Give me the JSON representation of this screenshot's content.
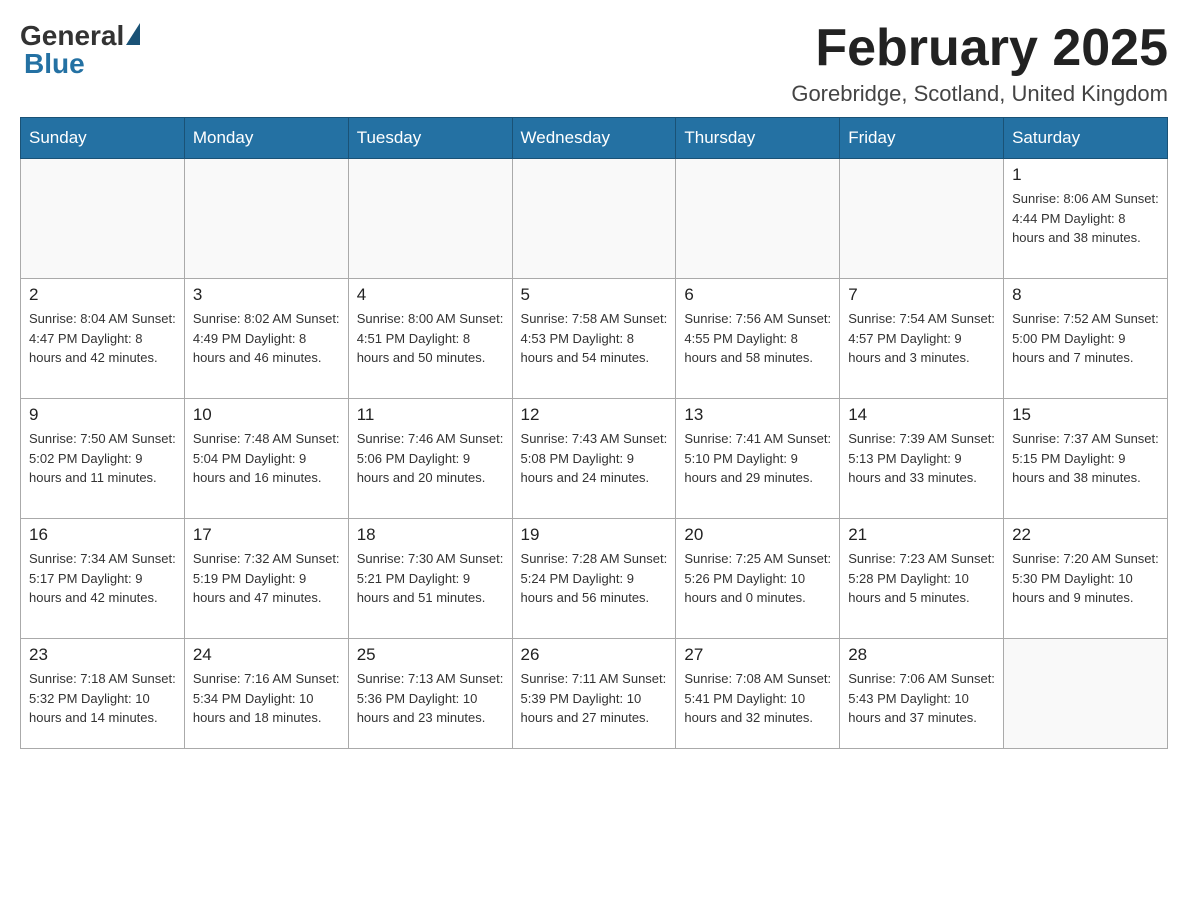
{
  "header": {
    "logo_general": "General",
    "logo_blue": "Blue",
    "title": "February 2025",
    "location": "Gorebridge, Scotland, United Kingdom"
  },
  "weekdays": [
    "Sunday",
    "Monday",
    "Tuesday",
    "Wednesday",
    "Thursday",
    "Friday",
    "Saturday"
  ],
  "weeks": [
    [
      {
        "day": "",
        "info": ""
      },
      {
        "day": "",
        "info": ""
      },
      {
        "day": "",
        "info": ""
      },
      {
        "day": "",
        "info": ""
      },
      {
        "day": "",
        "info": ""
      },
      {
        "day": "",
        "info": ""
      },
      {
        "day": "1",
        "info": "Sunrise: 8:06 AM\nSunset: 4:44 PM\nDaylight: 8 hours\nand 38 minutes."
      }
    ],
    [
      {
        "day": "2",
        "info": "Sunrise: 8:04 AM\nSunset: 4:47 PM\nDaylight: 8 hours\nand 42 minutes."
      },
      {
        "day": "3",
        "info": "Sunrise: 8:02 AM\nSunset: 4:49 PM\nDaylight: 8 hours\nand 46 minutes."
      },
      {
        "day": "4",
        "info": "Sunrise: 8:00 AM\nSunset: 4:51 PM\nDaylight: 8 hours\nand 50 minutes."
      },
      {
        "day": "5",
        "info": "Sunrise: 7:58 AM\nSunset: 4:53 PM\nDaylight: 8 hours\nand 54 minutes."
      },
      {
        "day": "6",
        "info": "Sunrise: 7:56 AM\nSunset: 4:55 PM\nDaylight: 8 hours\nand 58 minutes."
      },
      {
        "day": "7",
        "info": "Sunrise: 7:54 AM\nSunset: 4:57 PM\nDaylight: 9 hours\nand 3 minutes."
      },
      {
        "day": "8",
        "info": "Sunrise: 7:52 AM\nSunset: 5:00 PM\nDaylight: 9 hours\nand 7 minutes."
      }
    ],
    [
      {
        "day": "9",
        "info": "Sunrise: 7:50 AM\nSunset: 5:02 PM\nDaylight: 9 hours\nand 11 minutes."
      },
      {
        "day": "10",
        "info": "Sunrise: 7:48 AM\nSunset: 5:04 PM\nDaylight: 9 hours\nand 16 minutes."
      },
      {
        "day": "11",
        "info": "Sunrise: 7:46 AM\nSunset: 5:06 PM\nDaylight: 9 hours\nand 20 minutes."
      },
      {
        "day": "12",
        "info": "Sunrise: 7:43 AM\nSunset: 5:08 PM\nDaylight: 9 hours\nand 24 minutes."
      },
      {
        "day": "13",
        "info": "Sunrise: 7:41 AM\nSunset: 5:10 PM\nDaylight: 9 hours\nand 29 minutes."
      },
      {
        "day": "14",
        "info": "Sunrise: 7:39 AM\nSunset: 5:13 PM\nDaylight: 9 hours\nand 33 minutes."
      },
      {
        "day": "15",
        "info": "Sunrise: 7:37 AM\nSunset: 5:15 PM\nDaylight: 9 hours\nand 38 minutes."
      }
    ],
    [
      {
        "day": "16",
        "info": "Sunrise: 7:34 AM\nSunset: 5:17 PM\nDaylight: 9 hours\nand 42 minutes."
      },
      {
        "day": "17",
        "info": "Sunrise: 7:32 AM\nSunset: 5:19 PM\nDaylight: 9 hours\nand 47 minutes."
      },
      {
        "day": "18",
        "info": "Sunrise: 7:30 AM\nSunset: 5:21 PM\nDaylight: 9 hours\nand 51 minutes."
      },
      {
        "day": "19",
        "info": "Sunrise: 7:28 AM\nSunset: 5:24 PM\nDaylight: 9 hours\nand 56 minutes."
      },
      {
        "day": "20",
        "info": "Sunrise: 7:25 AM\nSunset: 5:26 PM\nDaylight: 10 hours\nand 0 minutes."
      },
      {
        "day": "21",
        "info": "Sunrise: 7:23 AM\nSunset: 5:28 PM\nDaylight: 10 hours\nand 5 minutes."
      },
      {
        "day": "22",
        "info": "Sunrise: 7:20 AM\nSunset: 5:30 PM\nDaylight: 10 hours\nand 9 minutes."
      }
    ],
    [
      {
        "day": "23",
        "info": "Sunrise: 7:18 AM\nSunset: 5:32 PM\nDaylight: 10 hours\nand 14 minutes."
      },
      {
        "day": "24",
        "info": "Sunrise: 7:16 AM\nSunset: 5:34 PM\nDaylight: 10 hours\nand 18 minutes."
      },
      {
        "day": "25",
        "info": "Sunrise: 7:13 AM\nSunset: 5:36 PM\nDaylight: 10 hours\nand 23 minutes."
      },
      {
        "day": "26",
        "info": "Sunrise: 7:11 AM\nSunset: 5:39 PM\nDaylight: 10 hours\nand 27 minutes."
      },
      {
        "day": "27",
        "info": "Sunrise: 7:08 AM\nSunset: 5:41 PM\nDaylight: 10 hours\nand 32 minutes."
      },
      {
        "day": "28",
        "info": "Sunrise: 7:06 AM\nSunset: 5:43 PM\nDaylight: 10 hours\nand 37 minutes."
      },
      {
        "day": "",
        "info": ""
      }
    ]
  ]
}
